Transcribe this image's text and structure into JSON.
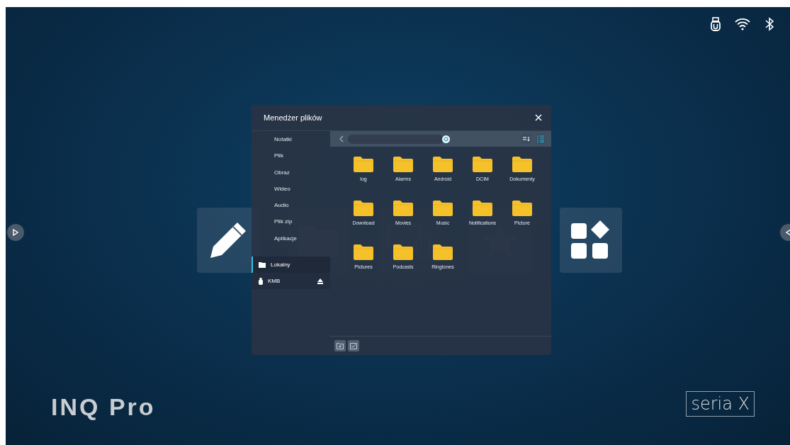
{
  "dialog": {
    "title": "Menedżer plików",
    "categories": [
      "Notatki",
      "Plik",
      "Obraz",
      "Wideo",
      "Audio",
      "Plik zip",
      "Aplikacje"
    ],
    "storage": [
      {
        "label": "Lokalny",
        "kind": "local",
        "selected": true
      },
      {
        "label": "KMB",
        "kind": "usb",
        "selected": false
      }
    ],
    "folders": [
      "log",
      "Alarms",
      "Android",
      "DCIM",
      "Dokumenty",
      "Download",
      "Movies",
      "Music",
      "Notifications",
      "Picture",
      "Pictures",
      "Podcasts",
      "Ringtones"
    ]
  },
  "brand": {
    "logo": "INQ Pro",
    "badge": "seria X"
  }
}
